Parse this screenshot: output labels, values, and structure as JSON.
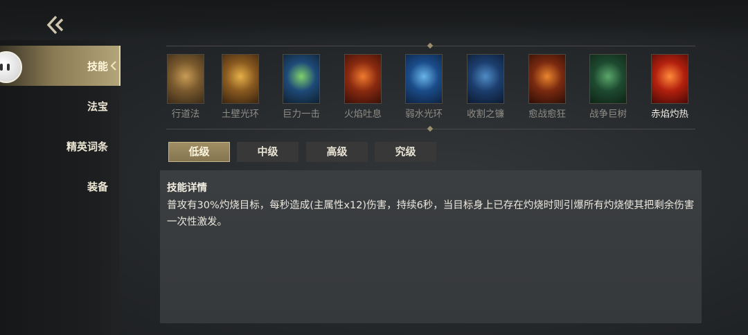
{
  "sidebar": {
    "items": [
      {
        "label": "技能",
        "active": true
      },
      {
        "label": "法宝",
        "active": false
      },
      {
        "label": "精英词条",
        "active": false
      },
      {
        "label": "装备",
        "active": false
      }
    ]
  },
  "skills": [
    {
      "name": "行道法",
      "icon": "golden-figure-icon",
      "colors": [
        "#7a5a2e",
        "#c89b55",
        "#3b2b18"
      ],
      "selected": false
    },
    {
      "name": "土壁光环",
      "icon": "earth-ring-icon",
      "colors": [
        "#8a5a20",
        "#e5b048",
        "#3a2410"
      ],
      "selected": false
    },
    {
      "name": "巨力一击",
      "icon": "green-strike-icon",
      "colors": [
        "#1e4a78",
        "#7fd16a",
        "#102030"
      ],
      "selected": false
    },
    {
      "name": "火焰吐息",
      "icon": "fire-breath-icon",
      "colors": [
        "#8a2a10",
        "#ef7a2e",
        "#3a1008"
      ],
      "selected": false
    },
    {
      "name": "弱水光环",
      "icon": "water-ring-icon",
      "colors": [
        "#1a4c8a",
        "#69b4ea",
        "#0e2240"
      ],
      "selected": false
    },
    {
      "name": "收割之镰",
      "icon": "scythe-icon",
      "colors": [
        "#1c3e6e",
        "#4f8cc6",
        "#0c1a30"
      ],
      "selected": false
    },
    {
      "name": "愈战愈狂",
      "icon": "berserk-icon",
      "colors": [
        "#7a2a10",
        "#e9852e",
        "#2e0e06"
      ],
      "selected": false
    },
    {
      "name": "战争巨树",
      "icon": "war-tree-icon",
      "colors": [
        "#1e4a30",
        "#5aa66a",
        "#0e2416"
      ],
      "selected": false
    },
    {
      "name": "赤焰灼热",
      "icon": "fire-dragon-icon",
      "colors": [
        "#b3200e",
        "#ff8a3a",
        "#4a0a06"
      ],
      "selected": true
    }
  ],
  "tiers": [
    {
      "label": "低级",
      "active": true
    },
    {
      "label": "中级",
      "active": false
    },
    {
      "label": "高级",
      "active": false
    },
    {
      "label": "究级",
      "active": false
    }
  ],
  "detail": {
    "title": "技能详情",
    "text": "普攻有30%灼烧目标，每秒造成(主属性x12)伤害，持续6秒，当目标身上已存在灼烧时则引爆所有灼烧使其把剩余伤害一次性激发。"
  }
}
